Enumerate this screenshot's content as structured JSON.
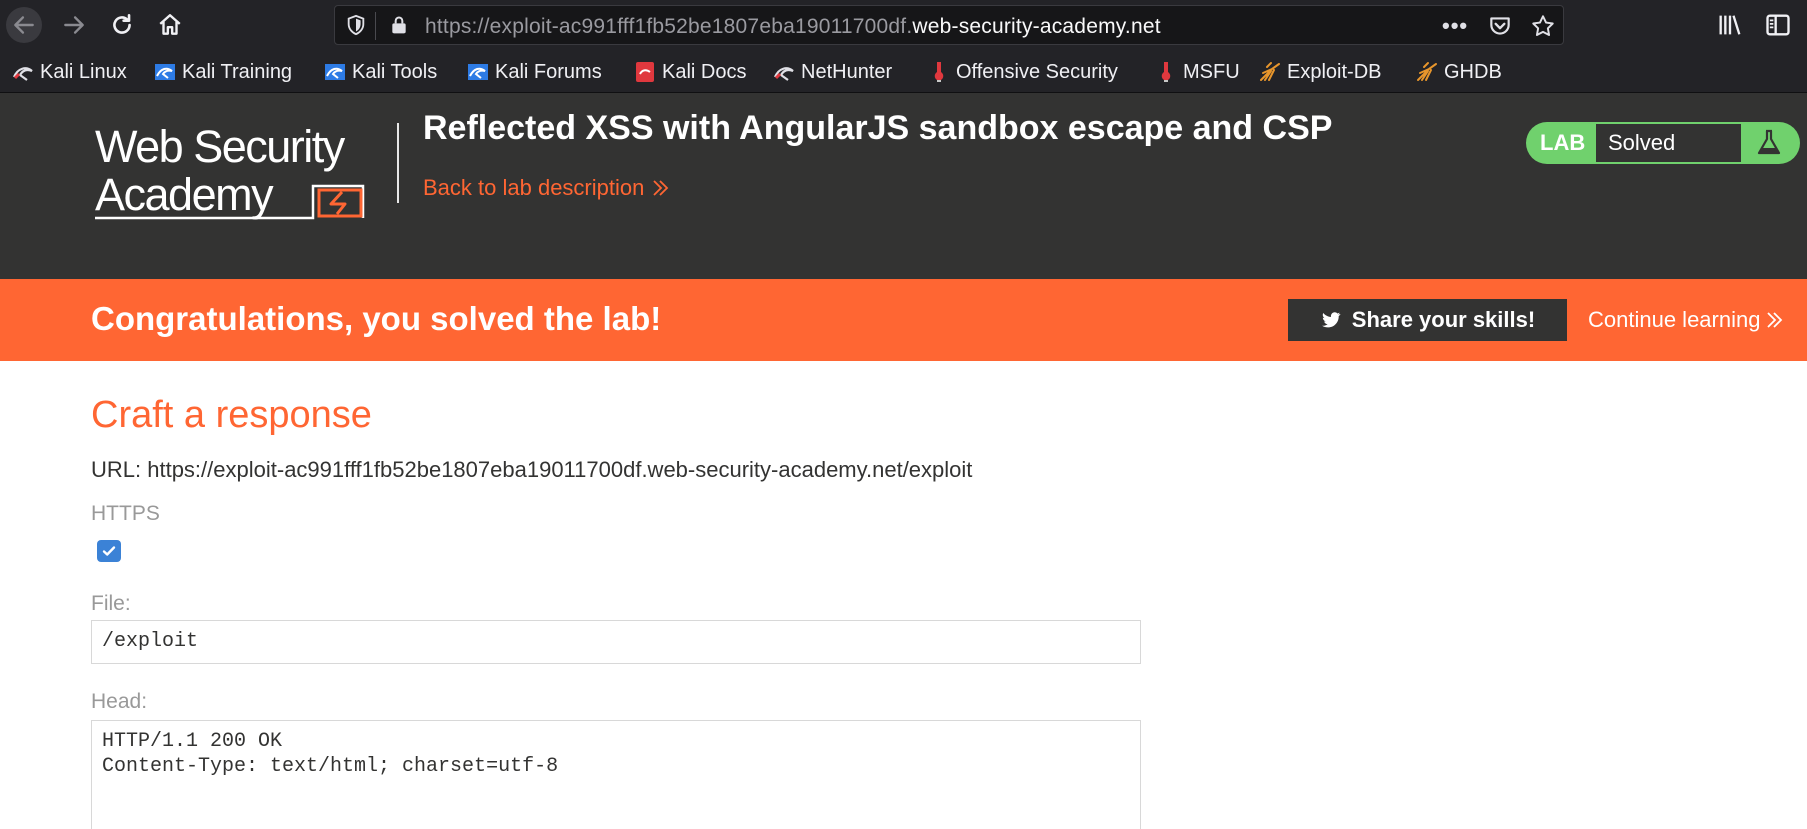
{
  "browser": {
    "url_prefix": "https://exploit-ac991fff1fb52be1807eba19011700df.",
    "url_domain": "web-security-academy.net",
    "icons": [
      "back-arrow-icon",
      "forward-arrow-icon",
      "reload-icon",
      "home-icon",
      "shield-icon",
      "lock-icon",
      "more-dots-icon",
      "pocket-icon",
      "star-icon",
      "library-icon",
      "sidebar-icon"
    ],
    "more_label": "•••"
  },
  "bookmarks": [
    {
      "label": "Kali Linux"
    },
    {
      "label": "Kali Training"
    },
    {
      "label": "Kali Tools"
    },
    {
      "label": "Kali Forums"
    },
    {
      "label": "Kali Docs"
    },
    {
      "label": "NetHunter"
    },
    {
      "label": "Offensive Security"
    },
    {
      "label": "MSFU"
    },
    {
      "label": "Exploit-DB"
    },
    {
      "label": "GHDB"
    }
  ],
  "header": {
    "logo_line1": "Web Security",
    "logo_line2": "Academy",
    "title": "Reflected XSS with AngularJS sandbox escape and CSP",
    "back_link": "Back to lab description",
    "lab_badge": "LAB",
    "lab_status": "Solved"
  },
  "banner": {
    "message": "Congratulations, you solved the lab!",
    "share_label": "Share your skills!",
    "continue_label": "Continue learning"
  },
  "form": {
    "heading": "Craft a response",
    "url_line": "URL: https://exploit-ac991fff1fb52be1807eba19011700df.web-security-academy.net/exploit",
    "https_label": "HTTPS",
    "https_checked": true,
    "file_label": "File:",
    "file_value": "/exploit",
    "head_label": "Head:",
    "head_value": "HTTP/1.1 200 OK\nContent-Type: text/html; charset=utf-8"
  },
  "colors": {
    "accent": "#ff6633",
    "header_bg": "#333332",
    "lab_green": "#70d16d",
    "checkbox_blue": "#3b82d6"
  }
}
